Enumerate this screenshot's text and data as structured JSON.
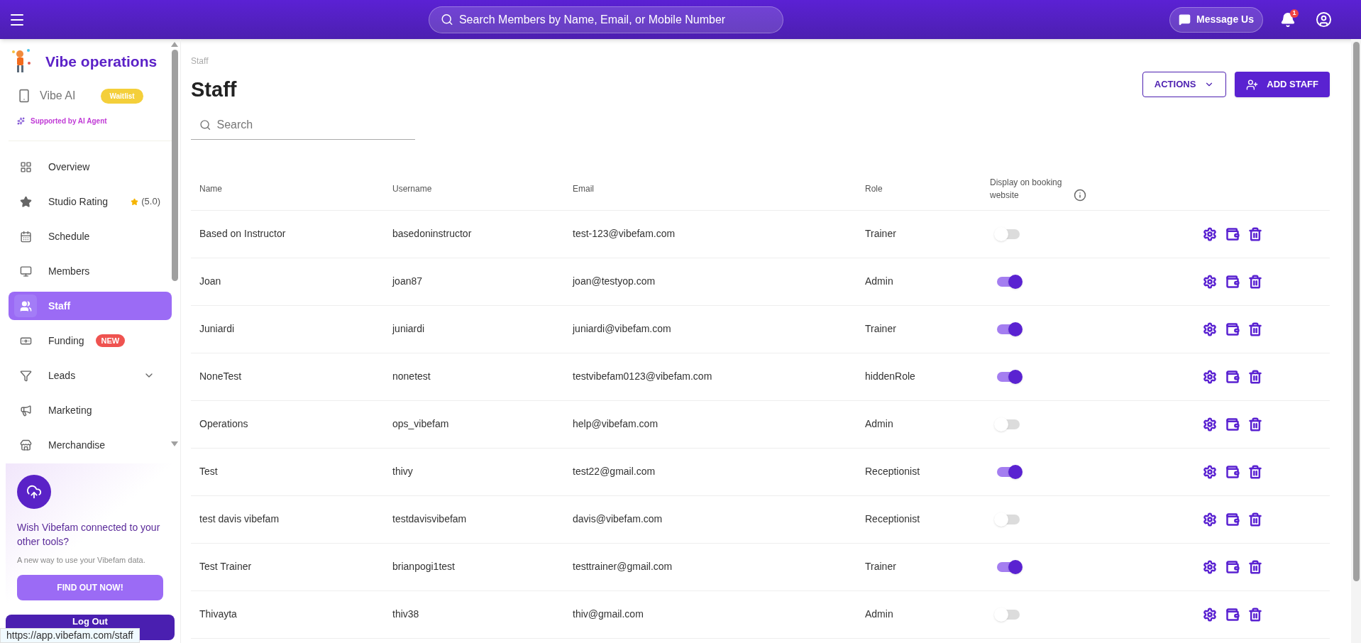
{
  "top_bar": {
    "search": {
      "placeholder": "Search Members by Name, Email, or Mobile Number"
    },
    "message_button": "Message Us",
    "notification_count": "1"
  },
  "sidebar": {
    "brand": "Vibe operations",
    "vibe_ai": {
      "label": "Vibe AI",
      "badge": "Waitlist",
      "note": "Supported by AI Agent"
    },
    "items": [
      {
        "kind": "overview",
        "label": "Overview",
        "selected": false
      },
      {
        "kind": "rating",
        "label": "Studio Rating",
        "rating": "(5.0)",
        "selected": false
      },
      {
        "kind": "schedule",
        "label": "Schedule",
        "selected": false
      },
      {
        "kind": "members",
        "label": "Members",
        "selected": false
      },
      {
        "kind": "staff",
        "label": "Staff",
        "selected": true
      },
      {
        "kind": "funding",
        "label": "Funding",
        "badge": "NEW",
        "selected": false
      },
      {
        "kind": "leads",
        "label": "Leads",
        "expanded": false,
        "selected": false
      },
      {
        "kind": "marketing",
        "label": "Marketing",
        "selected": false
      },
      {
        "kind": "merchandise",
        "label": "Merchandise",
        "selected": false
      }
    ],
    "promo": {
      "title": "Wish Vibefam connected to your other tools?",
      "text": "A new way to use your Vibefam data.",
      "button": "FIND OUT NOW!"
    },
    "logout": "Log Out"
  },
  "status_url": "https://app.vibefam.com/staff",
  "page": {
    "breadcrumb": "Staff",
    "title": "Staff",
    "actions_button": "ACTIONS",
    "add_button": "ADD STAFF",
    "search": {
      "placeholder": "Search"
    }
  },
  "table": {
    "columns": [
      "Name",
      "Username",
      "Email",
      "Role",
      "Display on booking website"
    ],
    "rows": [
      {
        "name": "Based on Instructor",
        "username": "basedoninstructor",
        "email": "test-123@vibefam.com",
        "role": "Trainer",
        "display": false
      },
      {
        "name": "Joan",
        "username": "joan87",
        "email": "joan@testyop.com",
        "role": "Admin",
        "display": true
      },
      {
        "name": "Juniardi",
        "username": "juniardi",
        "email": "juniardi@vibefam.com",
        "role": "Trainer",
        "display": true
      },
      {
        "name": "NoneTest",
        "username": "nonetest",
        "email": "testvibefam0123@vibefam.com",
        "role": "hiddenRole",
        "display": true
      },
      {
        "name": "Operations",
        "username": "ops_vibefam",
        "email": "help@vibefam.com",
        "role": "Admin",
        "display": false
      },
      {
        "name": "Test",
        "username": "thivy",
        "email": "test22@gmail.com",
        "role": "Receptionist",
        "display": true
      },
      {
        "name": "test davis vibefam",
        "username": "testdavisvibefam",
        "email": "davis@vibefam.com",
        "role": "Receptionist",
        "display": false
      },
      {
        "name": "Test Trainer",
        "username": "brianpogi1test",
        "email": "testtrainer@gmail.com",
        "role": "Trainer",
        "display": true
      },
      {
        "name": "Thivayta",
        "username": "thiv38",
        "email": "thiv@gmail.com",
        "role": "Admin",
        "display": false
      }
    ]
  }
}
